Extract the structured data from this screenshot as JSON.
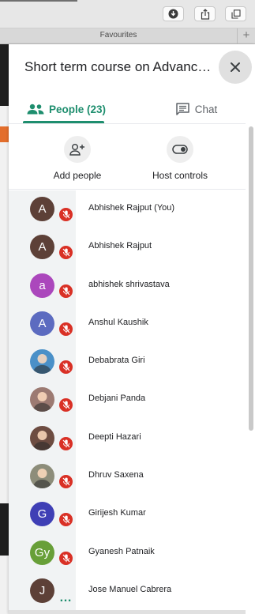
{
  "browser": {
    "favourites_label": "Favourites",
    "new_tab_label": "+",
    "buttons": [
      {
        "icon": "download-icon"
      },
      {
        "icon": "share-icon"
      },
      {
        "icon": "tabs-icon"
      }
    ]
  },
  "panel": {
    "title": "Short term course on Advances i…",
    "tabs": [
      {
        "label": "People (23)",
        "icon": "people-icon",
        "active": true
      },
      {
        "label": "Chat",
        "icon": "chat-icon",
        "active": false
      }
    ],
    "actions": [
      {
        "label": "Add people",
        "icon": "add-person-icon"
      },
      {
        "label": "Host controls",
        "icon": "toggle-icon"
      }
    ],
    "accent_color": "#1e8e6e",
    "participants": [
      {
        "name": "Abhishek Rajput (You)",
        "initial": "A",
        "color": "#5d4037",
        "mic": "muted"
      },
      {
        "name": "Abhishek Rajput",
        "initial": "A",
        "color": "#5d4037",
        "mic": "muted"
      },
      {
        "name": "abhishek shrivastava",
        "initial": "a",
        "color": "#ab47bc",
        "mic": "muted"
      },
      {
        "name": "Anshul Kaushik",
        "initial": "A",
        "color": "#5c6bc0",
        "mic": "muted"
      },
      {
        "name": "Debabrata Giri",
        "initial": "",
        "color": "#4a90c8",
        "mic": "muted",
        "photo": true
      },
      {
        "name": "Debjani Panda",
        "initial": "",
        "color": "#9c7a72",
        "mic": "muted",
        "photo": true
      },
      {
        "name": "Deepti Hazari",
        "initial": "",
        "color": "#6d4c41",
        "mic": "muted",
        "photo": true
      },
      {
        "name": "Dhruv Saxena",
        "initial": "",
        "color": "#8d8d7a",
        "mic": "muted",
        "photo": true
      },
      {
        "name": "Girijesh Kumar",
        "initial": "G",
        "color": "#3f3fb5",
        "mic": "muted"
      },
      {
        "name": "Gyanesh Patnaik",
        "initial": "Gy",
        "color": "#689f38",
        "mic": "muted"
      },
      {
        "name": "Jose Manuel Cabrera",
        "initial": "J",
        "color": "#5d4037",
        "mic": "speaking"
      }
    ]
  }
}
